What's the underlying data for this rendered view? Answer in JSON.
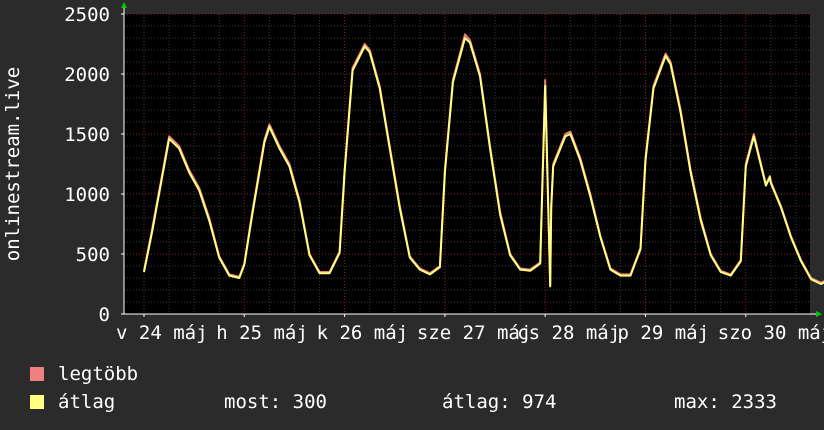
{
  "chart_data": {
    "type": "line",
    "ylabel": "onlinestream.live",
    "ylim": [
      0,
      2500
    ],
    "yticks": [
      0,
      500,
      1000,
      1500,
      2000,
      2500
    ],
    "grid": true,
    "xlim": [
      0,
      7
    ],
    "xtick_labels": [
      {
        "pos": 0.0,
        "text": "v 24 máj"
      },
      {
        "pos": 1.0,
        "text": "h 25 máj"
      },
      {
        "pos": 2.0,
        "text": "k 26 máj"
      },
      {
        "pos": 3.0,
        "text": "sze 27 máj"
      },
      {
        "pos": 4.0,
        "text": "cs 28 máj"
      },
      {
        "pos": 5.0,
        "text": "p 29 máj"
      },
      {
        "pos": 6.0,
        "text": "szo 30 máj"
      }
    ],
    "series": [
      {
        "name": "legtöbb",
        "color": "#f08080",
        "x": [
          0.0,
          0.08,
          0.2,
          0.25,
          0.35,
          0.45,
          0.55,
          0.65,
          0.75,
          0.85,
          0.95,
          1.0,
          1.08,
          1.2,
          1.25,
          1.35,
          1.45,
          1.55,
          1.65,
          1.75,
          1.85,
          1.95,
          2.0,
          2.08,
          2.2,
          2.25,
          2.35,
          2.45,
          2.55,
          2.65,
          2.75,
          2.85,
          2.95,
          3.0,
          3.08,
          3.2,
          3.25,
          3.35,
          3.45,
          3.55,
          3.65,
          3.75,
          3.85,
          3.95,
          4.0,
          4.05,
          4.06,
          4.08,
          4.2,
          4.25,
          4.35,
          4.45,
          4.55,
          4.65,
          4.75,
          4.85,
          4.95,
          5.0,
          5.08,
          5.2,
          5.25,
          5.35,
          5.45,
          5.55,
          5.65,
          5.75,
          5.85,
          5.95,
          6.0,
          6.08,
          6.2,
          6.24,
          6.25,
          6.35,
          6.45,
          6.55,
          6.65,
          6.75,
          6.85,
          6.95
        ],
        "values": [
          360,
          700,
          1250,
          1480,
          1400,
          1200,
          1050,
          800,
          480,
          330,
          310,
          420,
          850,
          1450,
          1580,
          1400,
          1250,
          950,
          500,
          350,
          350,
          520,
          1200,
          2050,
          2250,
          2200,
          1900,
          1400,
          900,
          480,
          380,
          340,
          400,
          1200,
          1950,
          2330,
          2280,
          2000,
          1400,
          850,
          500,
          380,
          370,
          430,
          1950,
          240,
          900,
          1250,
          1500,
          1520,
          1300,
          1000,
          650,
          380,
          330,
          330,
          550,
          1300,
          1900,
          2170,
          2100,
          1700,
          1200,
          800,
          500,
          360,
          330,
          450,
          1250,
          1500,
          1080,
          1150,
          1100,
          900,
          650,
          450,
          300,
          260,
          300,
          370
        ]
      },
      {
        "name": "átlag",
        "color": "#ffff80",
        "x": [
          0.0,
          0.08,
          0.2,
          0.25,
          0.35,
          0.45,
          0.55,
          0.65,
          0.75,
          0.85,
          0.95,
          1.0,
          1.08,
          1.2,
          1.25,
          1.35,
          1.45,
          1.55,
          1.65,
          1.75,
          1.85,
          1.95,
          2.0,
          2.08,
          2.2,
          2.25,
          2.35,
          2.45,
          2.55,
          2.65,
          2.75,
          2.85,
          2.95,
          3.0,
          3.08,
          3.2,
          3.25,
          3.35,
          3.45,
          3.55,
          3.65,
          3.75,
          3.85,
          3.95,
          4.0,
          4.05,
          4.06,
          4.08,
          4.2,
          4.25,
          4.35,
          4.45,
          4.55,
          4.65,
          4.75,
          4.85,
          4.95,
          5.0,
          5.08,
          5.2,
          5.25,
          5.35,
          5.45,
          5.55,
          5.65,
          5.75,
          5.85,
          5.95,
          6.0,
          6.08,
          6.2,
          6.24,
          6.25,
          6.35,
          6.45,
          6.55,
          6.65,
          6.75,
          6.85,
          6.95
        ],
        "values": [
          350,
          680,
          1230,
          1460,
          1380,
          1180,
          1030,
          780,
          470,
          320,
          300,
          410,
          830,
          1430,
          1560,
          1380,
          1230,
          930,
          490,
          340,
          340,
          510,
          1180,
          2030,
          2230,
          2180,
          1880,
          1380,
          880,
          470,
          370,
          330,
          390,
          1180,
          1930,
          2300,
          2260,
          1980,
          1380,
          830,
          490,
          370,
          360,
          420,
          1900,
          230,
          880,
          1230,
          1480,
          1500,
          1280,
          980,
          640,
          370,
          320,
          320,
          540,
          1280,
          1880,
          2150,
          2080,
          1680,
          1180,
          780,
          490,
          350,
          320,
          440,
          1230,
          1480,
          1070,
          1140,
          1090,
          890,
          640,
          440,
          290,
          250,
          290,
          300
        ]
      }
    ],
    "legend": [
      {
        "name": "legtöbb",
        "color": "#f08080"
      },
      {
        "name": "átlag",
        "color": "#ffff80"
      }
    ],
    "stats": {
      "now": "most: 300",
      "avg": "átlag: 974",
      "max": "max: 2333"
    }
  }
}
